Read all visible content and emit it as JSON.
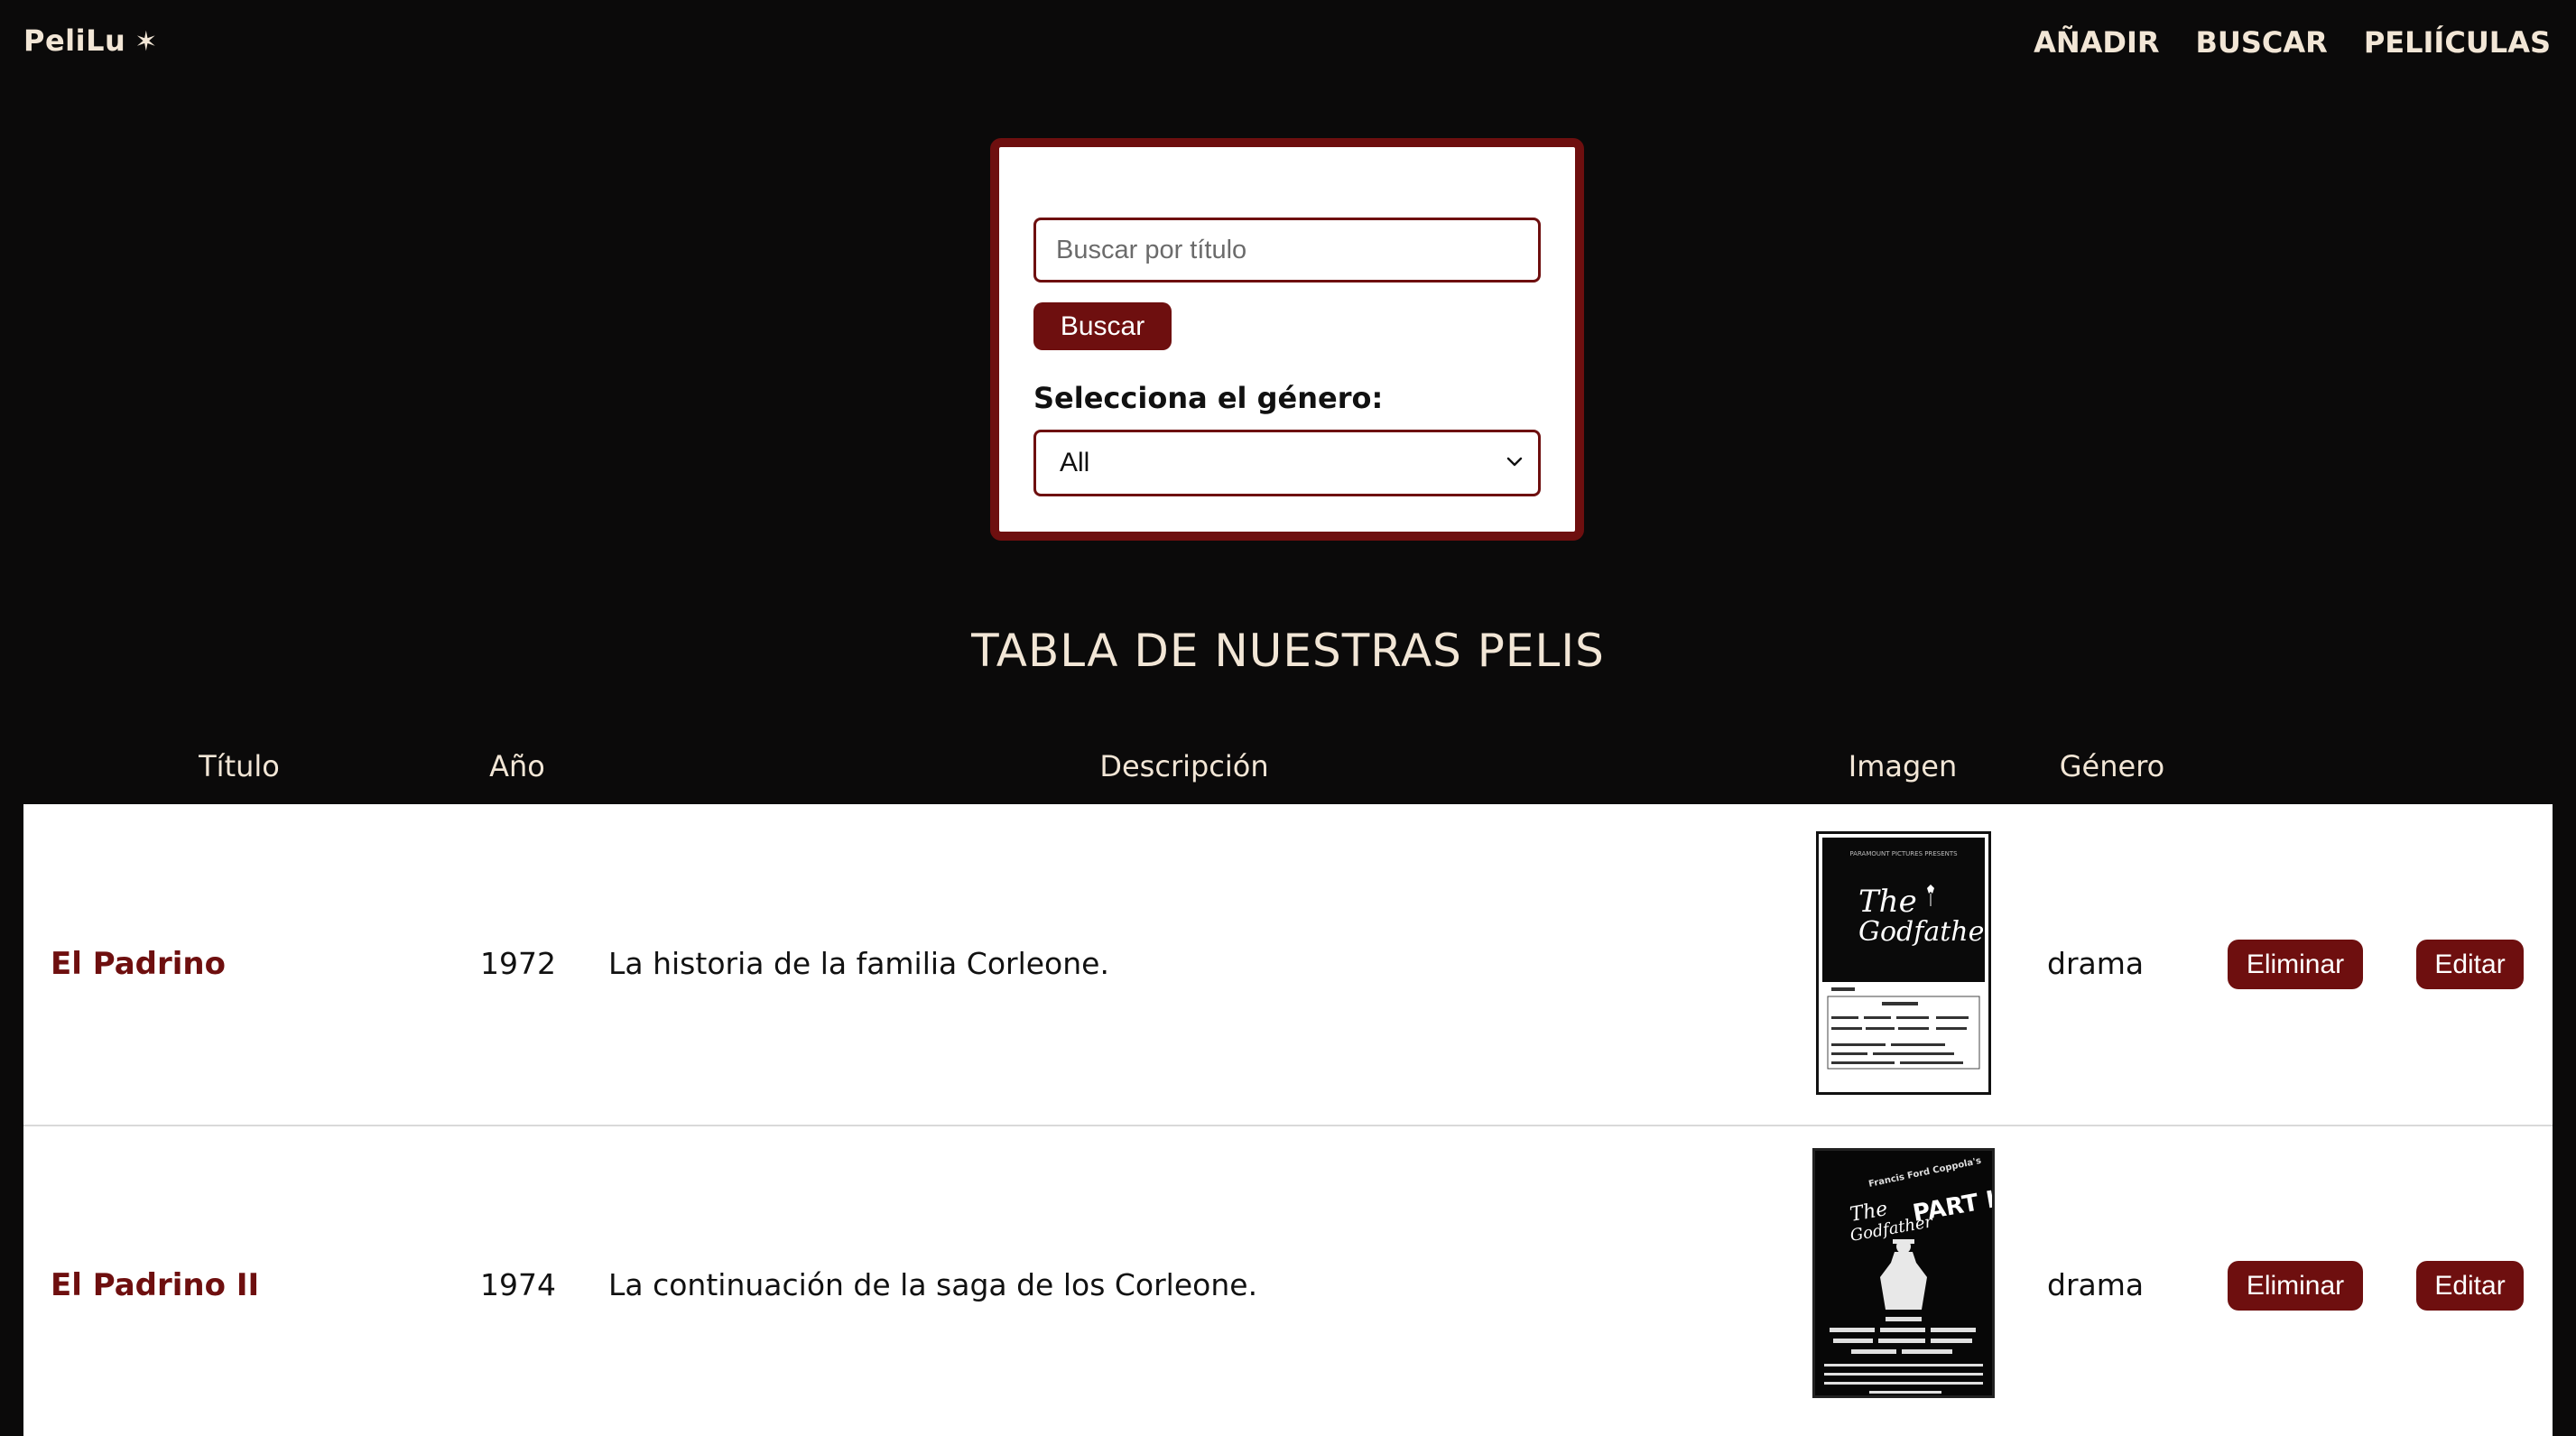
{
  "brand": {
    "name": "PeliLu",
    "star": "✶"
  },
  "nav": [
    {
      "label": "AÑADIR"
    },
    {
      "label": "BUSCAR"
    },
    {
      "label": "PELIÍCULAS"
    }
  ],
  "search": {
    "placeholder": "Buscar por título",
    "button_label": "Buscar",
    "genre_label": "Selecciona el género:",
    "genre_selected": "All"
  },
  "table": {
    "heading": "TABLA DE NUESTRAS PELIS",
    "columns": [
      "Título",
      "Año",
      "Descripción",
      "Imagen",
      "Género"
    ],
    "rows": [
      {
        "title": "El Padrino",
        "year": "1972",
        "description": "La historia de la familia Corleone.",
        "genre": "drama",
        "poster_icon": "godfather-poster",
        "delete_label": "Eliminar",
        "edit_label": "Editar"
      },
      {
        "title": "El Padrino II",
        "year": "1974",
        "description": "La continuación de la saga de los Corleone.",
        "genre": "drama",
        "poster_icon": "godfather-part-ii-poster",
        "delete_label": "Eliminar",
        "edit_label": "Editar"
      }
    ]
  },
  "colors": {
    "background": "#0b0a0a",
    "accent": "#6e0f0f",
    "text_light": "#f2e6d6"
  }
}
